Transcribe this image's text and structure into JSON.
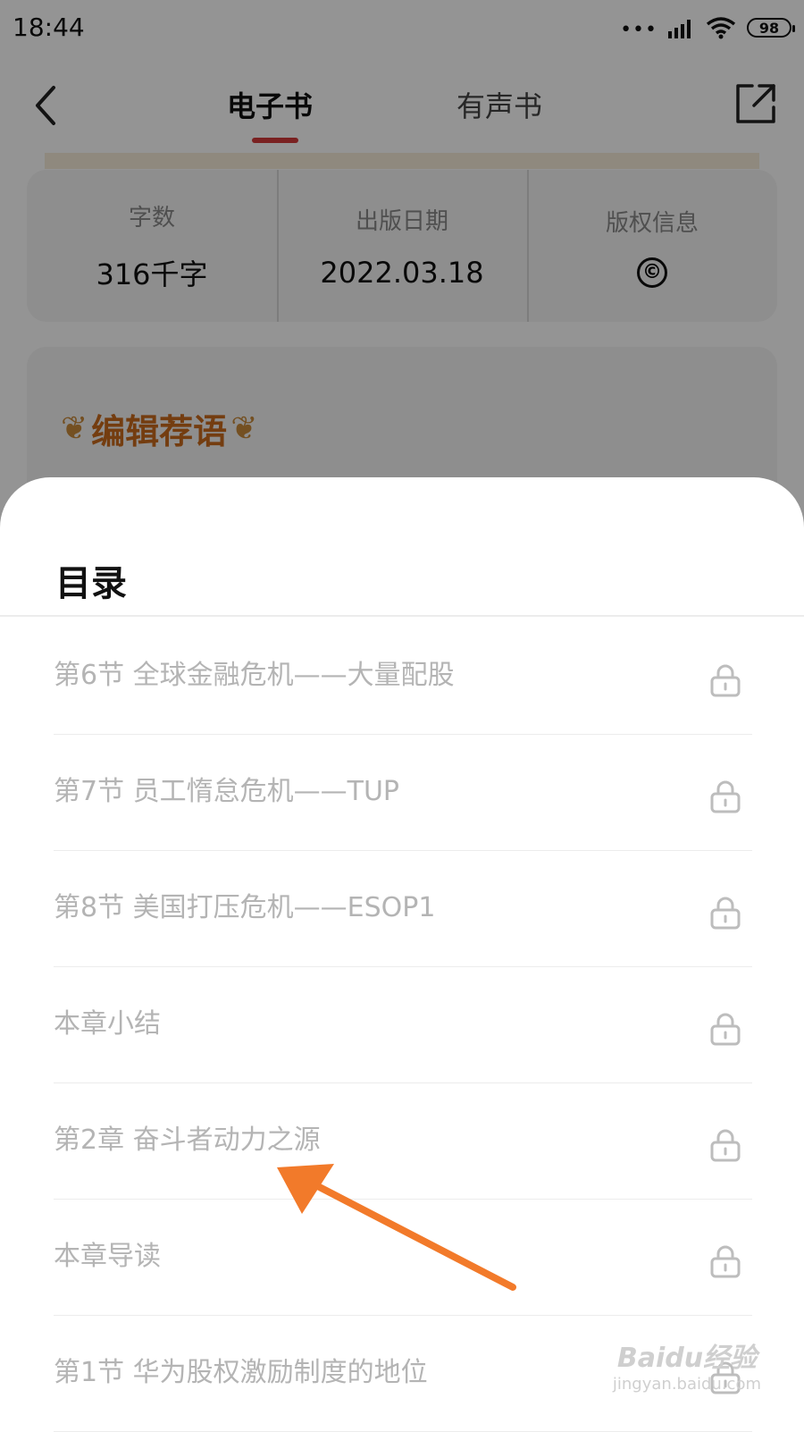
{
  "status_bar": {
    "time": "18:44",
    "battery": "98"
  },
  "nav": {
    "tabs": [
      {
        "label": "电子书",
        "active": true
      },
      {
        "label": "有声书",
        "active": false
      }
    ],
    "icons": {
      "back": "chevron-left-icon",
      "share": "share-external-icon"
    },
    "accent_color": "#d33a3a"
  },
  "book_info": [
    {
      "label": "字数",
      "value": "316千字"
    },
    {
      "label": "出版日期",
      "value": "2022.03.18"
    },
    {
      "label": "版权信息",
      "value": "©"
    }
  ],
  "editor_recommendation": {
    "title": "编辑荐语"
  },
  "sheet": {
    "title": "目录",
    "items": [
      {
        "text": "第6节 全球金融危机——大量配股",
        "locked": true
      },
      {
        "text": "第7节 员工惰怠危机——TUP",
        "locked": true
      },
      {
        "text": "第8节 美国打压危机——ESOP1",
        "locked": true
      },
      {
        "text": "本章小结",
        "locked": true
      },
      {
        "text": "第2章 奋斗者动力之源",
        "locked": true
      },
      {
        "text": "本章导读",
        "locked": true
      },
      {
        "text": "第1节 华为股权激励制度的地位",
        "locked": true
      }
    ]
  },
  "annotation": {
    "color": "#f27a2a"
  },
  "watermark": {
    "main": "Baidu经验",
    "sub": "jingyan.baidu.com"
  }
}
